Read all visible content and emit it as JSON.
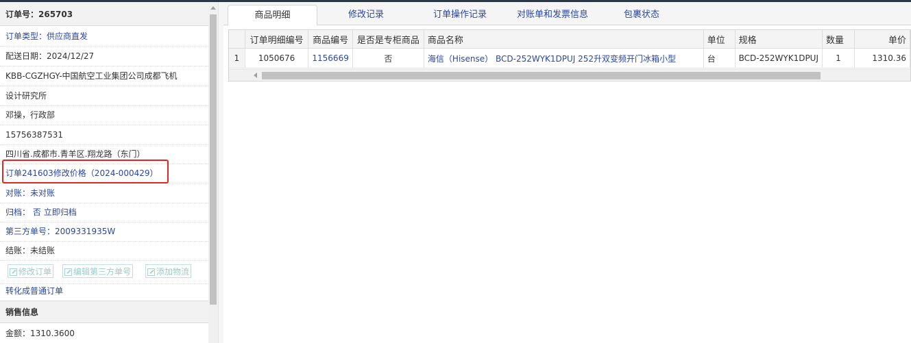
{
  "order": {
    "number_label": "订单号：265703",
    "type_label": "订单类型：",
    "type_value": "供应商直发",
    "delivery_date": "配送日期：2024/12/27",
    "customer_line1": "KBB-CGZHGY-中国航空工业集团公司成都飞机",
    "customer_line2": "设计研究所",
    "contact": "邓操，行政部",
    "phone": "15756387531",
    "address": "四川省.成都市.青羊区.翔龙路（东门）",
    "price_change_link": "订单241603修改价格（2024-000429）",
    "reconcile": "对账：未对账",
    "archive_label": "归档：",
    "archive_value": "否",
    "archive_action": "立即归档",
    "third_party_no": "第三方单号：2009331935W",
    "settlement": "结账：未结账",
    "buttons": {
      "edit_order": "修改订单",
      "edit_third_party": "编辑第三方单号",
      "add_logistics": "添加物流"
    },
    "convert_link": "转化成普通订单",
    "sales_section_title": "销售信息",
    "amount": "金额：1310.3600"
  },
  "tabs": [
    "商品明细",
    "修改记录",
    "订单操作记录",
    "对账单和发票信息",
    "包裹状态"
  ],
  "active_tab": 0,
  "table": {
    "headers": [
      "",
      "订单明细编号",
      "商品编号",
      "是否是专柜商品",
      "商品名称",
      "单位",
      "规格",
      "数量",
      "单价"
    ],
    "rows": [
      [
        "1",
        "1050676",
        "1156669",
        "否",
        "海信（Hisense） BCD-252WYK1DPUJ 252升双变频开门冰箱小型",
        "台",
        "BCD-252WYK1DPUJ",
        "1",
        "1310.36"
      ]
    ]
  },
  "colors": {
    "link": "#2a46a6",
    "highlight_border": "#e0261f",
    "disabled_button": "#9cc9c9"
  }
}
